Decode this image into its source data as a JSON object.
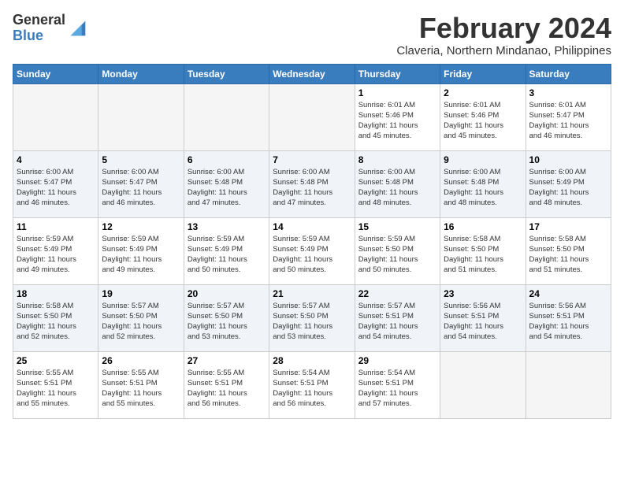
{
  "header": {
    "logo_line1": "General",
    "logo_line2": "Blue",
    "month_year": "February 2024",
    "location": "Claveria, Northern Mindanao, Philippines"
  },
  "days_of_week": [
    "Sunday",
    "Monday",
    "Tuesday",
    "Wednesday",
    "Thursday",
    "Friday",
    "Saturday"
  ],
  "weeks": [
    [
      {
        "day": "",
        "info": ""
      },
      {
        "day": "",
        "info": ""
      },
      {
        "day": "",
        "info": ""
      },
      {
        "day": "",
        "info": ""
      },
      {
        "day": "1",
        "info": "Sunrise: 6:01 AM\nSunset: 5:46 PM\nDaylight: 11 hours\nand 45 minutes."
      },
      {
        "day": "2",
        "info": "Sunrise: 6:01 AM\nSunset: 5:46 PM\nDaylight: 11 hours\nand 45 minutes."
      },
      {
        "day": "3",
        "info": "Sunrise: 6:01 AM\nSunset: 5:47 PM\nDaylight: 11 hours\nand 46 minutes."
      }
    ],
    [
      {
        "day": "4",
        "info": "Sunrise: 6:00 AM\nSunset: 5:47 PM\nDaylight: 11 hours\nand 46 minutes."
      },
      {
        "day": "5",
        "info": "Sunrise: 6:00 AM\nSunset: 5:47 PM\nDaylight: 11 hours\nand 46 minutes."
      },
      {
        "day": "6",
        "info": "Sunrise: 6:00 AM\nSunset: 5:48 PM\nDaylight: 11 hours\nand 47 minutes."
      },
      {
        "day": "7",
        "info": "Sunrise: 6:00 AM\nSunset: 5:48 PM\nDaylight: 11 hours\nand 47 minutes."
      },
      {
        "day": "8",
        "info": "Sunrise: 6:00 AM\nSunset: 5:48 PM\nDaylight: 11 hours\nand 48 minutes."
      },
      {
        "day": "9",
        "info": "Sunrise: 6:00 AM\nSunset: 5:48 PM\nDaylight: 11 hours\nand 48 minutes."
      },
      {
        "day": "10",
        "info": "Sunrise: 6:00 AM\nSunset: 5:49 PM\nDaylight: 11 hours\nand 48 minutes."
      }
    ],
    [
      {
        "day": "11",
        "info": "Sunrise: 5:59 AM\nSunset: 5:49 PM\nDaylight: 11 hours\nand 49 minutes."
      },
      {
        "day": "12",
        "info": "Sunrise: 5:59 AM\nSunset: 5:49 PM\nDaylight: 11 hours\nand 49 minutes."
      },
      {
        "day": "13",
        "info": "Sunrise: 5:59 AM\nSunset: 5:49 PM\nDaylight: 11 hours\nand 50 minutes."
      },
      {
        "day": "14",
        "info": "Sunrise: 5:59 AM\nSunset: 5:49 PM\nDaylight: 11 hours\nand 50 minutes."
      },
      {
        "day": "15",
        "info": "Sunrise: 5:59 AM\nSunset: 5:50 PM\nDaylight: 11 hours\nand 50 minutes."
      },
      {
        "day": "16",
        "info": "Sunrise: 5:58 AM\nSunset: 5:50 PM\nDaylight: 11 hours\nand 51 minutes."
      },
      {
        "day": "17",
        "info": "Sunrise: 5:58 AM\nSunset: 5:50 PM\nDaylight: 11 hours\nand 51 minutes."
      }
    ],
    [
      {
        "day": "18",
        "info": "Sunrise: 5:58 AM\nSunset: 5:50 PM\nDaylight: 11 hours\nand 52 minutes."
      },
      {
        "day": "19",
        "info": "Sunrise: 5:57 AM\nSunset: 5:50 PM\nDaylight: 11 hours\nand 52 minutes."
      },
      {
        "day": "20",
        "info": "Sunrise: 5:57 AM\nSunset: 5:50 PM\nDaylight: 11 hours\nand 53 minutes."
      },
      {
        "day": "21",
        "info": "Sunrise: 5:57 AM\nSunset: 5:50 PM\nDaylight: 11 hours\nand 53 minutes."
      },
      {
        "day": "22",
        "info": "Sunrise: 5:57 AM\nSunset: 5:51 PM\nDaylight: 11 hours\nand 54 minutes."
      },
      {
        "day": "23",
        "info": "Sunrise: 5:56 AM\nSunset: 5:51 PM\nDaylight: 11 hours\nand 54 minutes."
      },
      {
        "day": "24",
        "info": "Sunrise: 5:56 AM\nSunset: 5:51 PM\nDaylight: 11 hours\nand 54 minutes."
      }
    ],
    [
      {
        "day": "25",
        "info": "Sunrise: 5:55 AM\nSunset: 5:51 PM\nDaylight: 11 hours\nand 55 minutes."
      },
      {
        "day": "26",
        "info": "Sunrise: 5:55 AM\nSunset: 5:51 PM\nDaylight: 11 hours\nand 55 minutes."
      },
      {
        "day": "27",
        "info": "Sunrise: 5:55 AM\nSunset: 5:51 PM\nDaylight: 11 hours\nand 56 minutes."
      },
      {
        "day": "28",
        "info": "Sunrise: 5:54 AM\nSunset: 5:51 PM\nDaylight: 11 hours\nand 56 minutes."
      },
      {
        "day": "29",
        "info": "Sunrise: 5:54 AM\nSunset: 5:51 PM\nDaylight: 11 hours\nand 57 minutes."
      },
      {
        "day": "",
        "info": ""
      },
      {
        "day": "",
        "info": ""
      }
    ]
  ]
}
